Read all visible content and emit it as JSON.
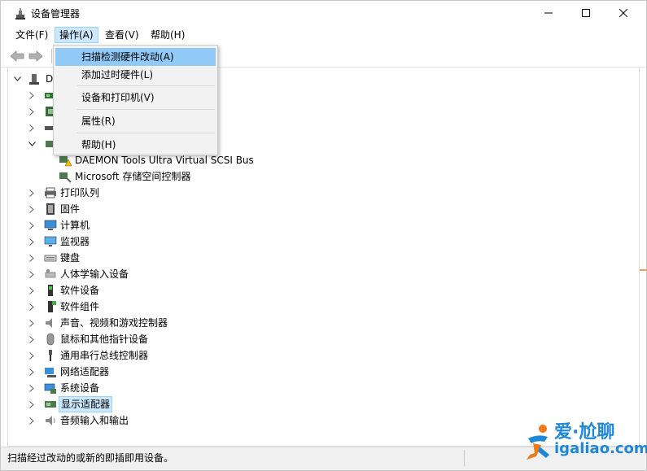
{
  "window": {
    "title": "设备管理器",
    "minimize_icon": "minimize-icon",
    "maximize_icon": "maximize-icon",
    "close_icon": "close-icon"
  },
  "menubar": {
    "file": "文件(F)",
    "action": "操作(A)",
    "view": "查看(V)",
    "help": "帮助(H)"
  },
  "dropdown": {
    "items": [
      "扫描检测硬件改动(A)",
      "添加过时硬件(L)",
      "设备和打印机(V)",
      "属性(R)",
      "帮助(H)"
    ]
  },
  "tree": {
    "root_label": "DE",
    "child_daemon": "DAEMON Tools Ultra Virtual SCSI Bus",
    "child_microsoft": "Microsoft 存储空间控制器",
    "categories": [
      "打印队列",
      "固件",
      "计算机",
      "监视器",
      "键盘",
      "人体学输入设备",
      "软件设备",
      "软件组件",
      "声音、视频和游戏控制器",
      "鼠标和其他指针设备",
      "通用串行总线控制器",
      "网络适配器",
      "系统设备",
      "显示适配器",
      "音频输入和输出"
    ]
  },
  "statusbar": {
    "text": "扫描经过改动的或新的即插即用设备。"
  },
  "watermark": {
    "line1": "爱·尬聊",
    "line2": "igaliao.com"
  },
  "colors": {
    "selection": "#cce8ff",
    "menu_highlight": "#91c9f7",
    "watermark_blue": "#1f88d6",
    "watermark_orange": "#f07a1a"
  }
}
